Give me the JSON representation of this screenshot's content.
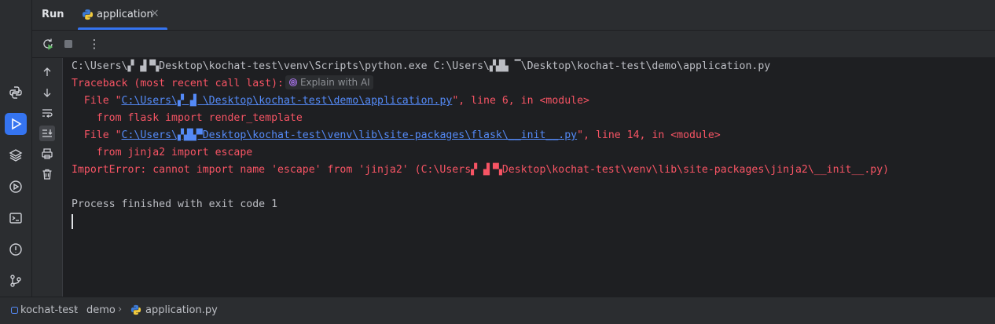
{
  "tool_window": {
    "title": "Run",
    "tab": {
      "label": "application",
      "close": "×",
      "icon": "python-file-icon"
    }
  },
  "activity_bar": {
    "items": [
      {
        "name": "python-packages-icon"
      },
      {
        "name": "run-icon",
        "active": true
      },
      {
        "name": "layers-icon"
      },
      {
        "name": "services-icon"
      },
      {
        "name": "terminal-icon"
      },
      {
        "name": "problems-icon"
      },
      {
        "name": "git-icon"
      }
    ]
  },
  "toolbar": {
    "rerun": "rerun-icon",
    "stop": "stop-icon",
    "more": "⋮"
  },
  "console": {
    "line1": "C:\\Users\\▞ ▟▝▚Desktop\\kochat-test\\venv\\Scripts\\python.exe C:\\Users\\▞▟▙ ▔\\Desktop\\kochat-test\\demo\\application.py",
    "traceback": "Traceback (most recent call last):",
    "explain_ai": "Explain with AI",
    "file1_prefix": "  File \"",
    "file1_path": "C:\\Users\\▞ ▟ \\Desktop\\kochat-test\\demo\\application.py",
    "file1_suffix": "\", line 6, in <module>",
    "code1": "    from flask import render_template",
    "file2_prefix": "  File \"",
    "file2_path": "C:\\Users\\▞▟▙▀Desktop\\kochat-test\\venv\\lib\\site-packages\\flask\\__init__.py",
    "file2_suffix": "\", line 14, in <module>",
    "code2": "    from jinja2 import escape",
    "import_error": "ImportError: cannot import name 'escape' from 'jinja2' (C:\\Users▞ ▟▝▚Desktop\\kochat-test\\venv\\lib\\site-packages\\jinja2\\__init__.py)",
    "exit": "Process finished with exit code 1"
  },
  "statusbar": {
    "project": "kochat-test",
    "folder": "demo",
    "file": "application.py"
  },
  "colors": {
    "accent": "#3574f0",
    "error": "#f75464",
    "link": "#548af7",
    "text": "#bcbec4"
  }
}
